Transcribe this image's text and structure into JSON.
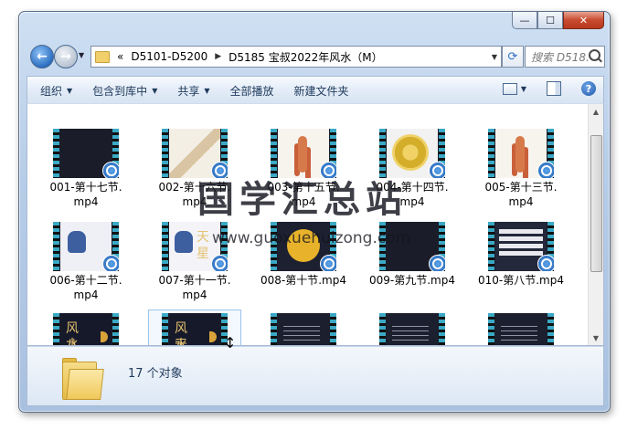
{
  "window": {
    "caption_buttons": {
      "minimize": "—",
      "maximize": "☐",
      "close": "✕"
    }
  },
  "nav": {
    "back_icon": "←",
    "forward_icon": "→",
    "dropdown_icon": "▼"
  },
  "address": {
    "overflow": "«",
    "separator": "▶",
    "crumbs": [
      "D5101-D5200",
      "D5185 宝叔2022年风水（M）"
    ],
    "dropdown_icon": "▼",
    "refresh_icon": "⟳"
  },
  "search": {
    "placeholder": "搜索 D518..."
  },
  "toolbar": {
    "items": [
      {
        "label": "组织",
        "has_menu": true
      },
      {
        "label": "包含到库中",
        "has_menu": true
      },
      {
        "label": "共享",
        "has_menu": true
      },
      {
        "label": "全部播放",
        "has_menu": false
      },
      {
        "label": "新建文件夹",
        "has_menu": false
      }
    ],
    "caret": "▼",
    "view_caret": "▼",
    "help": "?"
  },
  "files": [
    {
      "line1": "001-第十七节.",
      "line2": "mp4",
      "frame": "f-dark"
    },
    {
      "line1": "002-第十六节.",
      "line2": "mp4",
      "frame": "f-floor"
    },
    {
      "line1": "003-第十五节.",
      "line2": "mp4",
      "frame": "f-figure"
    },
    {
      "line1": "004-第十四节.",
      "line2": "mp4",
      "frame": "f-compass"
    },
    {
      "line1": "005-第十三节.",
      "line2": "mp4",
      "frame": "f-figure"
    },
    {
      "line1": "006-第十二节.",
      "line2": "mp4",
      "frame": "f-owl"
    },
    {
      "line1": "007-第十一节.",
      "line2": "mp4",
      "frame": "f-owl2"
    },
    {
      "line1": "008-第十节.mp4",
      "line2": "",
      "frame": "f-gold"
    },
    {
      "line1": "009-第九节.mp4",
      "line2": "",
      "frame": "f-dark"
    },
    {
      "line1": "010-第八节.mp4",
      "line2": "",
      "frame": "f-table"
    },
    {
      "line1": "",
      "line2": "",
      "frame": "f-title",
      "t1": "风八",
      "t2": "水宅"
    },
    {
      "line1": "",
      "line2": "",
      "frame": "f-title",
      "t1": "风天",
      "t2": "水星"
    },
    {
      "line1": "",
      "line2": "",
      "frame": "f-text"
    },
    {
      "line1": "",
      "line2": "",
      "frame": "f-text"
    },
    {
      "line1": "",
      "line2": "",
      "frame": "f-text"
    }
  ],
  "thumb_overlay": {
    "t1": "天",
    "t2": "星"
  },
  "scrollbar": {
    "up": "▲",
    "down": "▼"
  },
  "details": {
    "count": "17 个对象"
  },
  "watermark": {
    "title": "国学汇总站",
    "url": "www.guoxuehuizong.com"
  },
  "cursor": "↕"
}
